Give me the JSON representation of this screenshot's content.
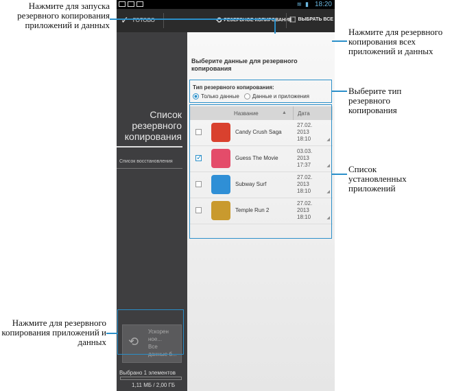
{
  "callouts": {
    "top_left": "Нажмите для запуска резервного копирования приложений и данных",
    "top_right": "Нажмите для резервного копирования всех приложений и данных",
    "type": "Выберите тип резервного копирования",
    "list": "Список установленных приложений",
    "bottom_left": "Нажмите для резервного копирования приложений и данных"
  },
  "status": {
    "time": "18:20"
  },
  "actionbar": {
    "done_label": "ГОТОВО",
    "backup_label": "РЕЗЕРВНОЕ КОПИРОВАНИЕ",
    "select_all_label": "ВЫБРАТЬ ВСЕ"
  },
  "sidebar": {
    "title_line1": "Список",
    "title_line2": "резервного",
    "title_line3": "копирования",
    "restore_label": "Список восстановления",
    "quick_l1": "Ускорен",
    "quick_l2": "ное...",
    "quick_l3": "Все",
    "quick_l4": "данные б...",
    "selected_count": "Выбрано 1 элементов",
    "size": "1,11 МБ / 2,00 ГБ"
  },
  "main": {
    "title_line1": "Выберите данные для резервного",
    "title_line2": "копирования",
    "type_label": "Тип резервного копирования:",
    "option_data_only": "Только данные",
    "option_data_apps": "Данные и приложения",
    "col_name": "Название",
    "col_date": "Дата"
  },
  "apps": [
    {
      "name": "Candy Crush Saga",
      "d1": "27.02.",
      "d2": "2013",
      "d3": "18:10",
      "checked": false,
      "color": "#d9412e"
    },
    {
      "name": "Guess The Movie",
      "d1": "03.03.",
      "d2": "2013",
      "d3": "17:37",
      "checked": true,
      "color": "#e44c6a"
    },
    {
      "name": "Subway Surf",
      "d1": "27.02.",
      "d2": "2013",
      "d3": "18:10",
      "checked": false,
      "color": "#2f8fd6"
    },
    {
      "name": "Temple Run 2",
      "d1": "27.02.",
      "d2": "2013",
      "d3": "18:10",
      "checked": false,
      "color": "#c99a2e"
    }
  ]
}
